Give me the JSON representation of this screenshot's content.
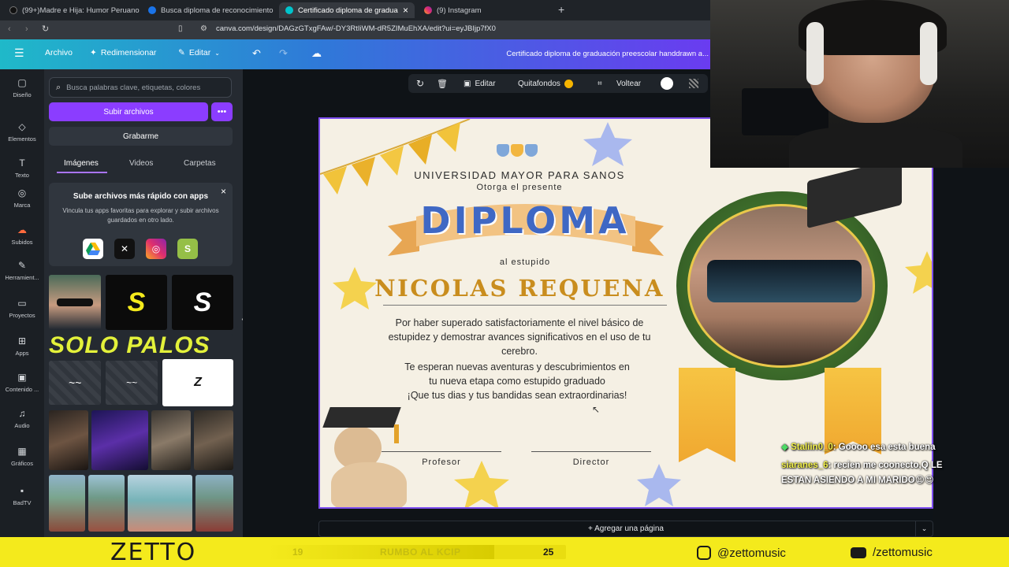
{
  "browser": {
    "tabs": [
      {
        "label": "(99+)Madre e Hija: Humor Peruano",
        "color": "#111"
      },
      {
        "label": "Busca diploma de reconocimiento",
        "color": "#1a73e8"
      },
      {
        "label": "Certificado diploma de gradua",
        "color": "#00c4cc"
      },
      {
        "label": "(9) Instagram",
        "color": "#e1306c"
      }
    ],
    "new_tab": "+",
    "close_tab": "×",
    "url": "canva.com/design/DAGzGTxgFAw/-DY3RtIiWM-dR5ZIMuEhXA/edit?ui=eyJBIjp7fX0"
  },
  "header": {
    "menu_icon": "hamburger-icon",
    "archivo": "Archivo",
    "redimensionar": "Redimensionar",
    "editar": "Editar",
    "doc_title": "Certificado diploma de graduación preescolar handdrawn a..."
  },
  "rail": [
    {
      "label": "Diseño",
      "icon": "▢"
    },
    {
      "label": "Elementos",
      "icon": "◇"
    },
    {
      "label": "Texto",
      "icon": "T"
    },
    {
      "label": "Marca",
      "icon": "◎"
    },
    {
      "label": "Subidos",
      "icon": "☁"
    },
    {
      "label": "Herramient...",
      "icon": "✎"
    },
    {
      "label": "Proyectos",
      "icon": "▭"
    },
    {
      "label": "Apps",
      "icon": "⊞"
    },
    {
      "label": "Contenido ...",
      "icon": "▣"
    },
    {
      "label": "Audio",
      "icon": "♫"
    },
    {
      "label": "Gráficos",
      "icon": "▦"
    },
    {
      "label": "BadTV",
      "icon": "▪"
    }
  ],
  "panel": {
    "search_placeholder": "Busca palabras clave, etiquetas, colores",
    "upload": "Subir archivos",
    "more": "•••",
    "record": "Grabarme",
    "tabs": [
      "Imágenes",
      "Videos",
      "Carpetas"
    ],
    "apps_card": {
      "title": "Sube archivos más rápido con apps",
      "subtitle": "Vincula tus apps favoritas para explorar y subir archivos guardados en otro lado.",
      "close": "×"
    },
    "solo_palos": "SOLO PALOS"
  },
  "toolbar": {
    "editar": "Editar",
    "quitafondos": "Quitafondos",
    "voltear": "Voltear"
  },
  "diploma": {
    "university": "UNIVERSIDAD MAYOR PARA SANOS",
    "otorga": "Otorga el presente",
    "title": "DIPLOMA",
    "al": "al estupido",
    "name": "NICOLAS REQUENA",
    "body1": "Por haber superado satisfactoriamente el nivel básico de",
    "body2": "estupidez y demostrar avances significativos en el uso de tu",
    "body3": "cerebro.",
    "body4": "Te esperan nuevas aventuras y descubrimientos en",
    "body5": "tu nueva etapa como estupido graduado",
    "body6": "¡Que tus dias y tus bandidas sean extraordinarias!",
    "sig1": "Profesor",
    "sig2": "Director"
  },
  "add_page": "+ Agregar una página",
  "chat": [
    {
      "user": "Staliin0_0",
      "msg": ": Goooo esa esta buena"
    },
    {
      "user": "siaranes_6",
      "msg": ": recien me coonecto,Q LE"
    },
    {
      "user": "",
      "msg": "ESTAN ASIENDO A MI MARIDO😫😍"
    }
  ],
  "bottombar": {
    "logo": "ZETTO",
    "num_left": "19",
    "goal": "RUMBO AL KCIP",
    "num_right": "25",
    "progress": 0.76,
    "instagram": "@zettomusic",
    "youtube": "/zettomusic"
  }
}
